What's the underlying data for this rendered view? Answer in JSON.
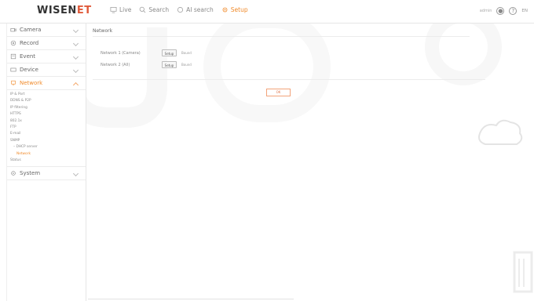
{
  "header": {
    "logo_main": "WISEN",
    "logo_accent": "ET",
    "nav": [
      {
        "label": "Live",
        "icon": "monitor-icon",
        "active": false
      },
      {
        "label": "Search",
        "icon": "search-icon",
        "active": false
      },
      {
        "label": "AI search",
        "icon": "ai-search-icon",
        "active": false
      },
      {
        "label": "Setup",
        "icon": "gear-icon",
        "active": true
      }
    ],
    "user_text": "admin",
    "lang": "EN"
  },
  "sidebar": {
    "menus": [
      {
        "label": "Camera",
        "icon": "camera-icon"
      },
      {
        "label": "Record",
        "icon": "record-icon"
      },
      {
        "label": "Event",
        "icon": "event-icon"
      },
      {
        "label": "Device",
        "icon": "device-icon"
      },
      {
        "label": "Network",
        "icon": "network-icon"
      }
    ],
    "network_sub": [
      "IP & Port",
      "DDNS & P2P",
      "IP filtering",
      "HTTPS",
      "802.1x",
      "FTP",
      "E-mail",
      "SNMP",
      "DHCP server",
      "Network",
      "Status"
    ],
    "system_label": "System"
  },
  "main": {
    "title": "Network",
    "rows": [
      {
        "label": "Network 1 (Camera)",
        "button": "Setup",
        "status": "Bound"
      },
      {
        "label": "Network 2 (All)",
        "button": "Setup",
        "status": "Bound"
      }
    ],
    "ok_label": "OK"
  },
  "colors": {
    "accent": "#f08a2a",
    "text": "#666666",
    "border": "#e6e6e6"
  }
}
